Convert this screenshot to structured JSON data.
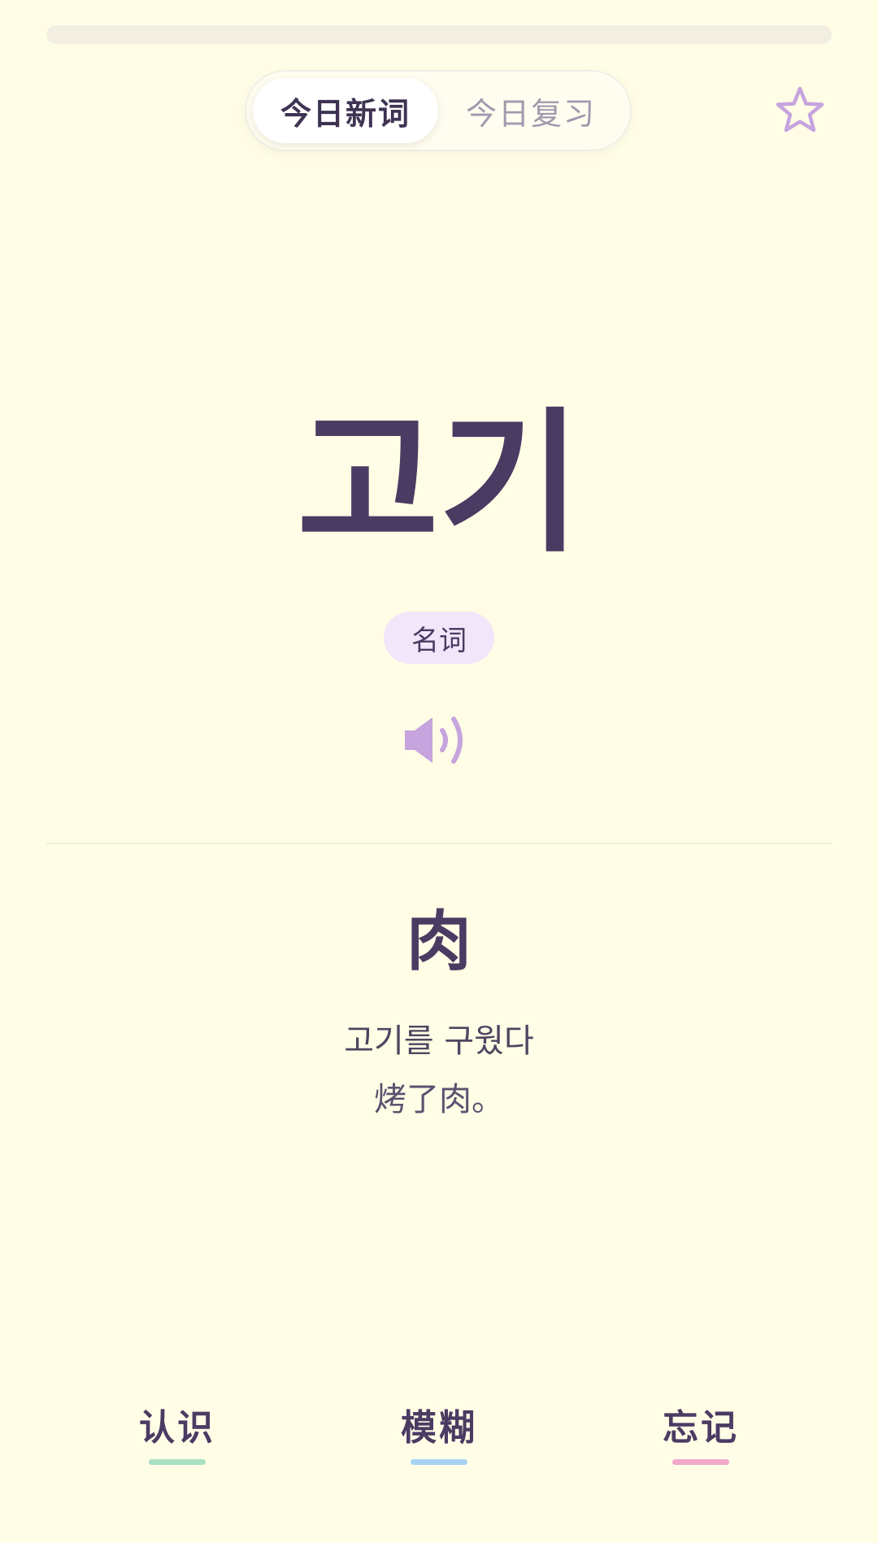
{
  "progress": {
    "fraction": 0
  },
  "tabs": [
    {
      "label": "今日新词",
      "active": true
    },
    {
      "label": "今日复习",
      "active": false
    }
  ],
  "card": {
    "word": "고기",
    "part_of_speech": "名词",
    "meaning": "肉",
    "example_korean": "고기를 구웠다",
    "example_chinese": "烤了肉。"
  },
  "icons": {
    "favorite": "star-outline-icon",
    "audio": "speaker-icon"
  },
  "actions": [
    {
      "label": "认识",
      "color": "#A8E0C4"
    },
    {
      "label": "模糊",
      "color": "#A9D2F2"
    },
    {
      "label": "忘记",
      "color": "#F2A9CB"
    }
  ],
  "colors": {
    "background": "#FFFDE6",
    "text_primary": "#4A3B63",
    "accent_purple": "#C6A4DE",
    "badge_bg": "#F1E6FA"
  }
}
